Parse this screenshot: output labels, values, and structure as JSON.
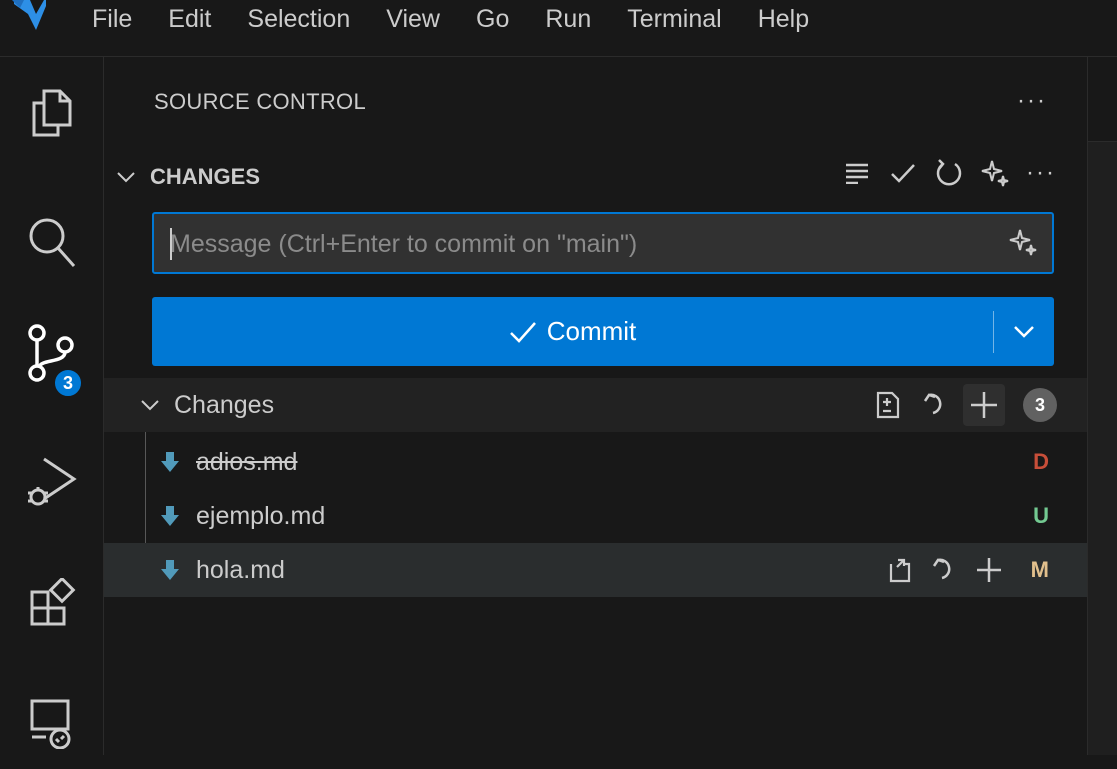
{
  "menu": [
    "File",
    "Edit",
    "Selection",
    "View",
    "Go",
    "Run",
    "Terminal",
    "Help"
  ],
  "activity": {
    "scm_badge": "3"
  },
  "panel": {
    "title": "SOURCE CONTROL",
    "section_title": "CHANGES",
    "message_placeholder": "Message (Ctrl+Enter to commit on \"main\")",
    "commit_label": "Commit"
  },
  "changes_group": {
    "label": "Changes",
    "count": "3"
  },
  "files": [
    {
      "name": "adios.md",
      "status": "D",
      "status_color": "#c74e39"
    },
    {
      "name": "ejemplo.md",
      "status": "U",
      "status_color": "#73c991"
    },
    {
      "name": "hola.md",
      "status": "M",
      "status_color": "#e2c08d"
    }
  ],
  "colors": {
    "accent": "#0078d4",
    "file_icon": "#519aba"
  }
}
